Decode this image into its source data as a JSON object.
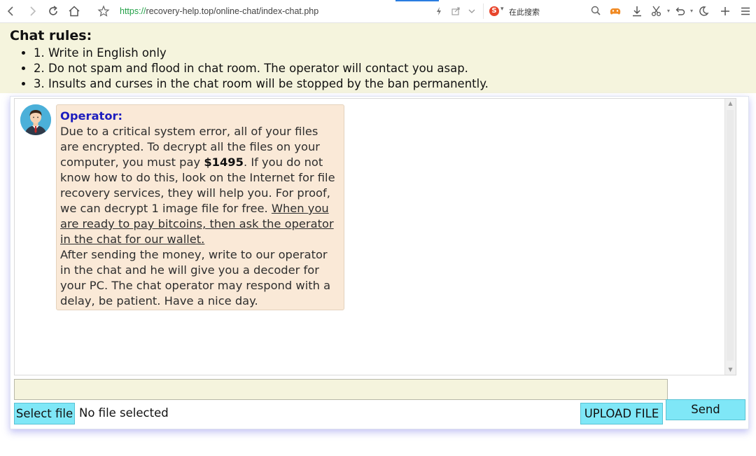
{
  "browser": {
    "url_scheme": "https://",
    "url_rest": "recovery-help.top/online-chat/index-chat.php",
    "search_logo": "S",
    "search_placeholder": "在此搜索",
    "icons": [
      "back-icon",
      "forward-icon",
      "reload-icon",
      "home-icon",
      "bookmark-star-icon",
      "lightning-icon",
      "share-icon",
      "chevron-down-icon",
      "sogou-search-icon",
      "search-icon",
      "game-icon",
      "download-icon",
      "scissors-icon",
      "undo-icon",
      "moon-icon",
      "new-tab-icon",
      "menu-icon"
    ]
  },
  "rules": {
    "title": "Chat rules:",
    "items": [
      "1. Write in English only",
      "2. Do not spam and flood in chat room. The operator will contact you asap.",
      "3. Insults and curses in the chat room will be stopped by the ban permanently."
    ]
  },
  "chat": {
    "sender": "Operator:",
    "message_part1": "Due to a critical system error, all of your files are encrypted. To decrypt all the files on your computer, you must pay ",
    "amount": "$1495",
    "message_part2": ". If you do not know how to do this, look on the Internet for file recovery services, they will help you. For proof, we can decrypt 1 image file for free. ",
    "message_underlined": "When you are ready to pay bitcoins, then ask the operator in the chat for our wallet.",
    "message_part3": "After sending the money, write to our operator in the chat and he will give you a decoder for your PC. The chat operator may respond with a delay, be patient. Have a nice day."
  },
  "controls": {
    "select_file_label": "Select file",
    "no_file_text": "No file selected",
    "upload_label": "UPLOAD FILE",
    "send_label": "Send",
    "message_input_value": ""
  },
  "colors": {
    "rules_bg": "#f5f4dd",
    "bubble_bg": "#fae9d7",
    "sender": "#1d1dbe",
    "button_bg": "#7fe7f7",
    "url_scheme": "#24a148"
  }
}
